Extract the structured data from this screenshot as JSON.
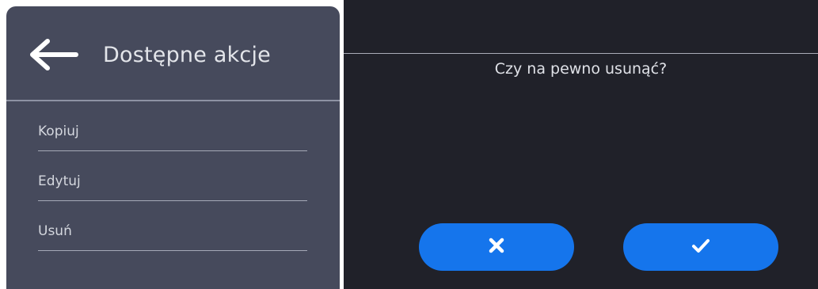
{
  "left_panel": {
    "title": "Dostępne akcje",
    "back_icon": "arrow-left-icon",
    "items": [
      {
        "label": "Kopiuj"
      },
      {
        "label": "Edytuj"
      },
      {
        "label": "Usuń"
      }
    ]
  },
  "dialog": {
    "question": "Czy na pewno usunąć?",
    "cancel_icon": "close-icon",
    "confirm_icon": "check-icon"
  },
  "colors": {
    "left_panel_bg": "#464a5c",
    "dialog_bg": "#202129",
    "button_accent": "#1575ec"
  }
}
